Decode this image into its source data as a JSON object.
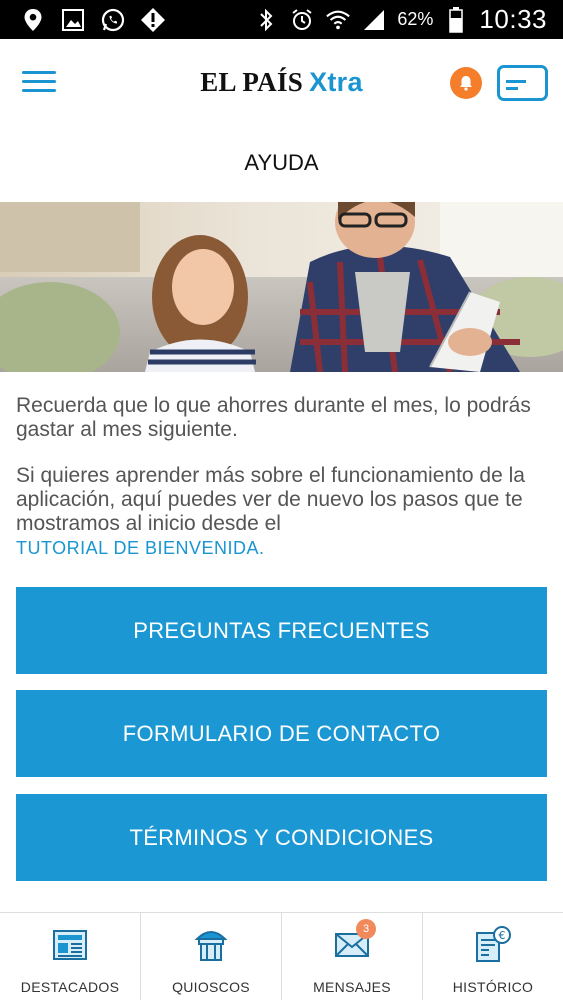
{
  "status_bar": {
    "battery_percent": "62%",
    "time": "10:33",
    "left_icons": [
      "location-icon",
      "gallery-icon",
      "whatsapp-icon",
      "alert-icon"
    ],
    "right_icons": [
      "bluetooth-icon",
      "alarm-icon",
      "wifi-icon",
      "signal-icon",
      "battery-icon"
    ]
  },
  "header": {
    "logo_main": "EL PAÍS",
    "logo_accent": "Xtra",
    "menu_icon": "hamburger-icon",
    "bell_icon": "bell-icon",
    "card_icon": "card-icon"
  },
  "page": {
    "title": "AYUDA"
  },
  "content": {
    "paragraph_1": "Recuerda que lo que ahorres durante el mes, lo podrás gastar al mes siguiente.",
    "paragraph_2": "Si quieres aprender más sobre el funcionamiento de la aplicación, aquí puedes ver de nuevo los pasos que te mostramos al inicio desde el",
    "tutorial_link": "TUTORIAL DE BIENVENIDA."
  },
  "buttons": {
    "faq": "PREGUNTAS FRECUENTES",
    "contact": "FORMULARIO DE CONTACTO",
    "terms": "TÉRMINOS Y CONDICIONES"
  },
  "bottom_nav": {
    "items": [
      {
        "label": "DESTACADOS",
        "icon": "newspaper-icon"
      },
      {
        "label": "QUIOSCOS",
        "icon": "kiosk-icon"
      },
      {
        "label": "MENSAJES",
        "icon": "envelope-icon",
        "badge": "3"
      },
      {
        "label": "HISTÓRICO",
        "icon": "receipt-euro-icon"
      }
    ]
  },
  "colors": {
    "accent": "#1a95d1",
    "button": "#1b98d3",
    "bell": "#f47e2a",
    "badge": "#f08a5d"
  }
}
